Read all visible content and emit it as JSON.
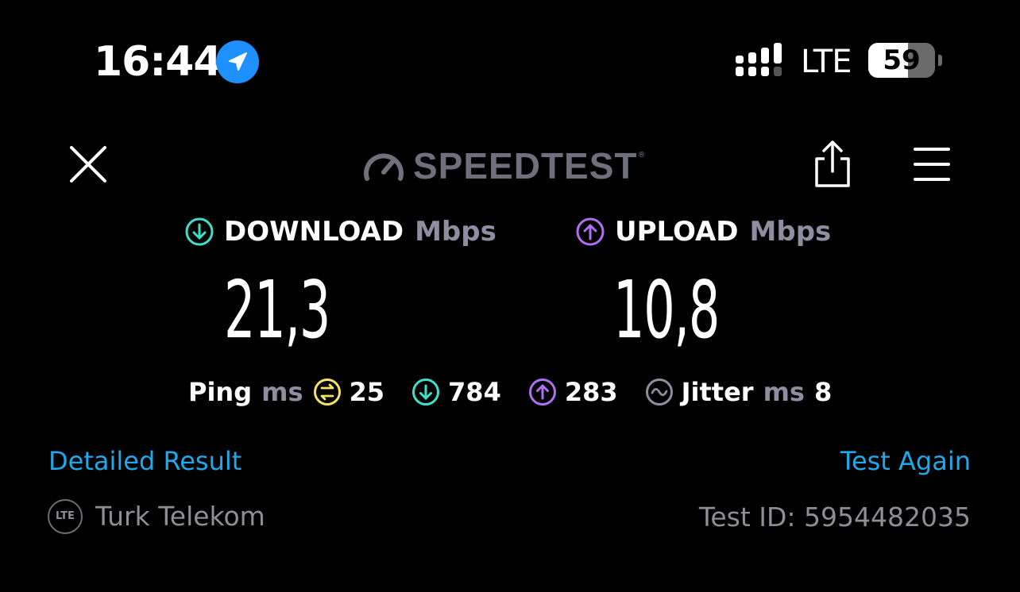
{
  "status_bar": {
    "time": "16:44",
    "network": "LTE",
    "battery_percent": "59",
    "battery_level": 0.59
  },
  "header": {
    "logo_text": "SPEEDTEST",
    "logo_mark": "®",
    "icons": [
      "close-icon",
      "speedometer-icon",
      "share-icon",
      "menu-icon"
    ]
  },
  "download": {
    "label": "DOWNLOAD",
    "unit": "Mbps",
    "value": "21,3",
    "color": "#3fe0c8"
  },
  "upload": {
    "label": "UPLOAD",
    "unit": "Mbps",
    "value": "10,8",
    "color": "#b070f0"
  },
  "stats": {
    "ping_label": "Ping",
    "ping_unit": "ms",
    "ping_idle": "25",
    "ping_download": "784",
    "ping_upload": "283",
    "jitter_label": "Jitter",
    "jitter_unit": "ms",
    "jitter_value": "8",
    "idle_color": "#f5e06a",
    "jitter_color": "#8e8ea0"
  },
  "footer": {
    "detailed_result": "Detailed Result",
    "test_again": "Test Again",
    "carrier_badge": "LTE",
    "carrier_name": "Turk Telekom",
    "test_id": "Test ID: 5954482035",
    "link_color": "#1fa8ea"
  }
}
